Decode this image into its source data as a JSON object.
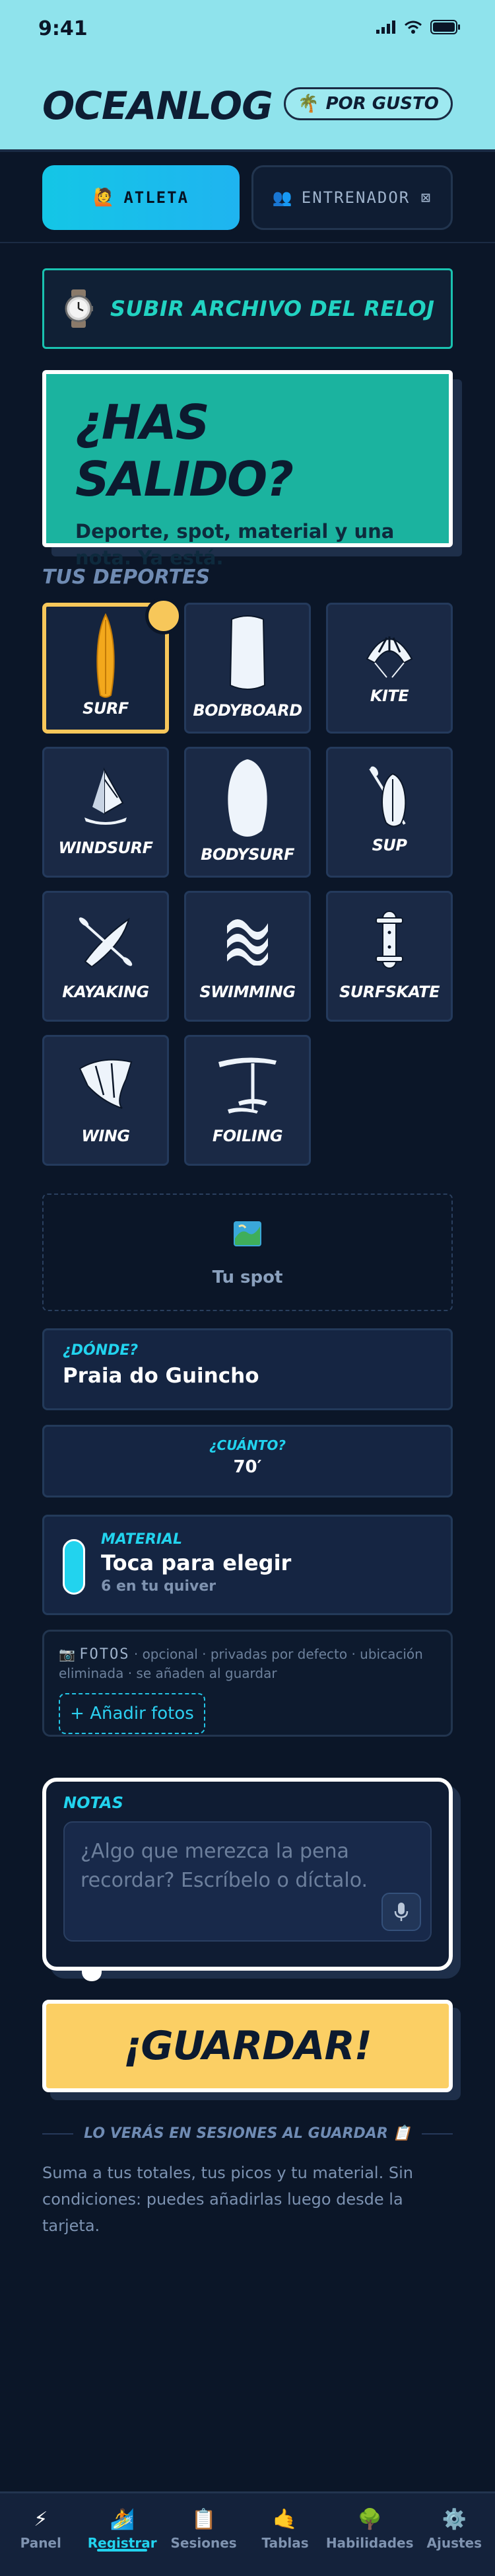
{
  "status": {
    "time": "9:41"
  },
  "header": {
    "app_title": "OCEANLOG",
    "mode_label": "POR GUSTO",
    "mode_icon": "palm-tree-icon"
  },
  "roles": [
    {
      "label": "ATLETA",
      "icon": "🙋",
      "active": true
    },
    {
      "label": "ENTRENADOR ⊠",
      "icon": "👥",
      "active": false
    }
  ],
  "upload": {
    "label": "SUBIR ARCHIVO DEL RELOJ",
    "icon": "watch-icon"
  },
  "hero": {
    "title": "¿HAS SALIDO?",
    "subtitle": "Deporte, spot, material y una nota. Ya está."
  },
  "sports_section": {
    "title": "TUS DEPORTES",
    "items": [
      {
        "label": "SURF",
        "icon": "surfboard-icon",
        "selected": true
      },
      {
        "label": "BODYBOARD",
        "icon": "bodyboard-icon",
        "selected": false
      },
      {
        "label": "KITE",
        "icon": "kite-icon",
        "selected": false
      },
      {
        "label": "WINDSURF",
        "icon": "windsurf-icon",
        "selected": false
      },
      {
        "label": "BODYSURF",
        "icon": "bodysurf-icon",
        "selected": false
      },
      {
        "label": "SUP",
        "icon": "sup-paddle-icon",
        "selected": false
      },
      {
        "label": "KAYAKING",
        "icon": "kayak-icon",
        "selected": false
      },
      {
        "label": "SWIMMING",
        "icon": "waves-icon",
        "selected": false
      },
      {
        "label": "SURFSKATE",
        "icon": "skateboard-icon",
        "selected": false
      },
      {
        "label": "WING",
        "icon": "wing-icon",
        "selected": false
      },
      {
        "label": "FOILING",
        "icon": "foil-icon",
        "selected": false
      }
    ]
  },
  "spot": {
    "label": "Tu spot",
    "icon": "map-icon"
  },
  "where": {
    "label": "¿DÓNDE?",
    "value": "Praia do Guincho"
  },
  "how_much": {
    "label": "¿CUÁNTO?",
    "value": "70′"
  },
  "gear": {
    "label": "MATERIAL",
    "value": "Toca para elegir",
    "sub": "6 en tu quiver"
  },
  "photos": {
    "title": "FOTOS",
    "meta": "· opcional · privadas por defecto · ubicación eliminada · se añaden al guardar",
    "add_label": "+ Añadir fotos"
  },
  "notes": {
    "label": "NOTAS",
    "placeholder": "¿Algo que merezca la pena recordar? Escríbelo o díctalo."
  },
  "save": {
    "label": "¡GUARDAR!"
  },
  "info": {
    "title": "LO VERÁS EN SESIONES AL GUARDAR 📋",
    "text": "Suma a tus totales, tus picos y tu material. Sin condiciones: puedes añadirlas luego desde la tarjeta."
  },
  "nav": [
    {
      "label": "Panel",
      "icon": "⚡",
      "active": false
    },
    {
      "label": "Registrar",
      "icon": "🏄",
      "active": true
    },
    {
      "label": "Sesiones",
      "icon": "📋",
      "active": false
    },
    {
      "label": "Tablas",
      "icon": "🤙",
      "active": false
    },
    {
      "label": "Habilidades",
      "icon": "🌳",
      "active": false
    },
    {
      "label": "Ajustes",
      "icon": "⚙️",
      "active": false
    }
  ],
  "colors": {
    "accent_cyan": "#22d3ee",
    "accent_yellow": "#fbcf64",
    "teal": "#1bb39f",
    "background": "#0b1628"
  }
}
